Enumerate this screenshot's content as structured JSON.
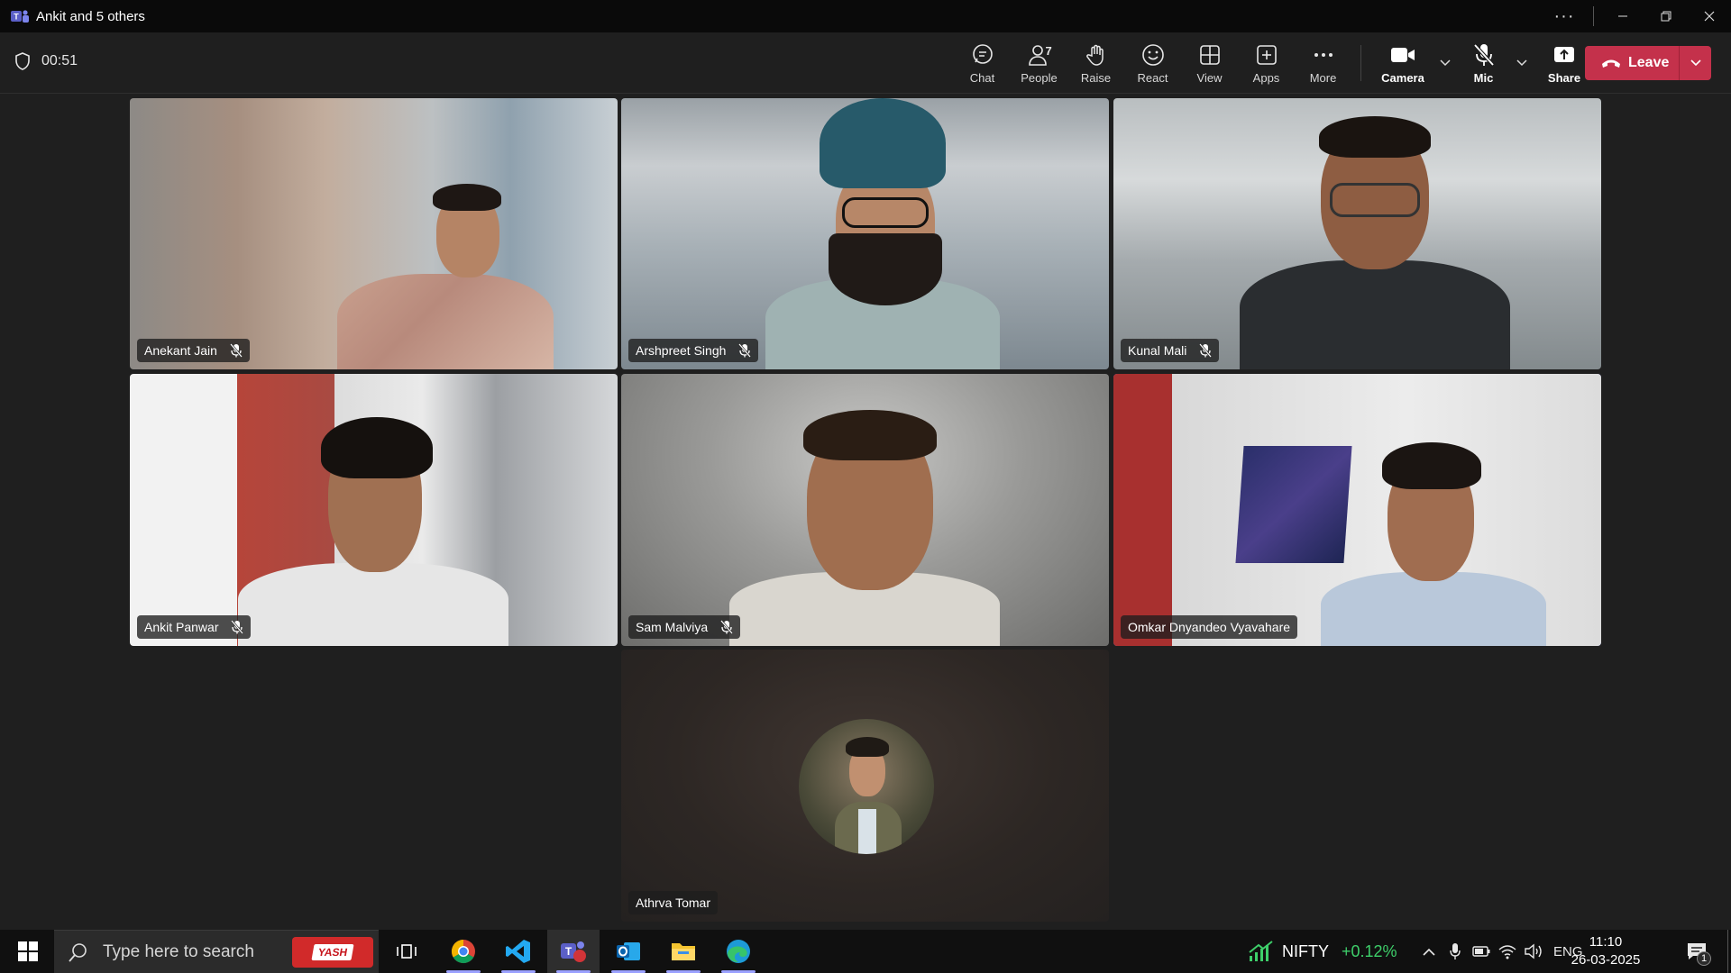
{
  "window": {
    "title": "Ankit and 5 others"
  },
  "meeting": {
    "timer": "00:51",
    "toolbar": {
      "chat": "Chat",
      "people": "People",
      "people_count": "7",
      "raise": "Raise",
      "react": "React",
      "view": "View",
      "apps": "Apps",
      "more": "More",
      "camera": "Camera",
      "mic": "Mic",
      "share": "Share",
      "leave": "Leave"
    },
    "participants": [
      {
        "name": "Anekant Jain",
        "muted": true
      },
      {
        "name": "Arshpreet Singh",
        "muted": true
      },
      {
        "name": "Kunal Mali",
        "muted": true
      },
      {
        "name": "Ankit Panwar",
        "muted": true
      },
      {
        "name": "Sam Malviya",
        "muted": true
      },
      {
        "name": "Omkar Dnyandeo Vyavahare",
        "muted": false,
        "speaking": true
      },
      {
        "name": "Athrva Tomar",
        "muted": false,
        "video": false
      }
    ],
    "colors": {
      "leave": "#c4314b",
      "active_speaker": "#7f85f5"
    }
  },
  "taskbar": {
    "search_placeholder": "Type here to search",
    "search_badge": "YASH",
    "ticker_name": "NIFTY",
    "ticker_change": "+0.12%",
    "language": "ENG",
    "time": "11:10",
    "date": "26-03-2025",
    "notification_count": "1"
  }
}
